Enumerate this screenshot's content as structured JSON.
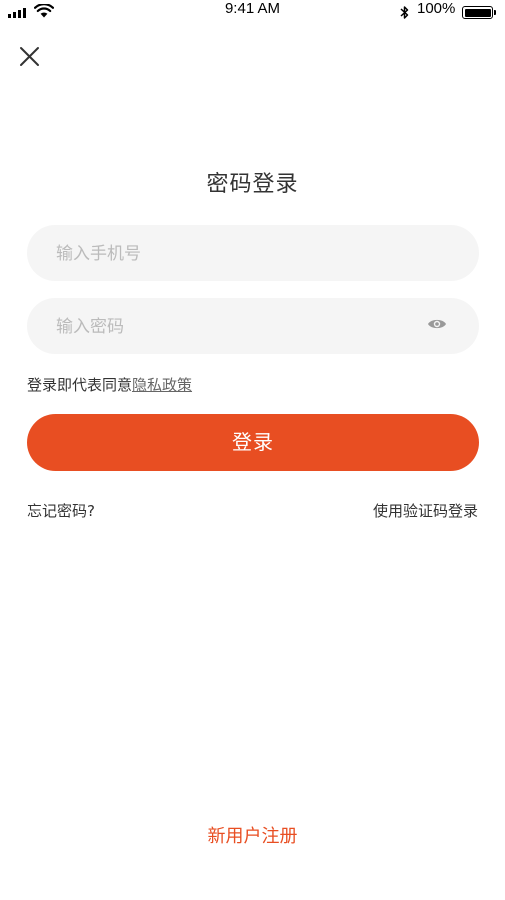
{
  "status_bar": {
    "time": "9:41 AM",
    "battery_percent": "100%",
    "icons": [
      "signal-icon",
      "wifi-icon",
      "bluetooth-icon",
      "battery-icon"
    ]
  },
  "header": {
    "close_icon": "close-icon",
    "title": "密码登录"
  },
  "form": {
    "phone_placeholder": "输入手机号",
    "phone_value": "",
    "password_placeholder": "输入密码",
    "password_value": "",
    "show_password_icon": "eye-icon",
    "agreement_prefix": "登录即代表同意",
    "agreement_link": "隐私政策",
    "login_label": "登录"
  },
  "links": {
    "forgot_password": "忘记密码?",
    "sms_login": "使用验证码登录"
  },
  "footer": {
    "register_label": "新用户注册"
  },
  "colors": {
    "accent": "#e84e22",
    "input_bg": "#f5f5f5",
    "text": "#333333",
    "placeholder": "#bbbbbb"
  }
}
